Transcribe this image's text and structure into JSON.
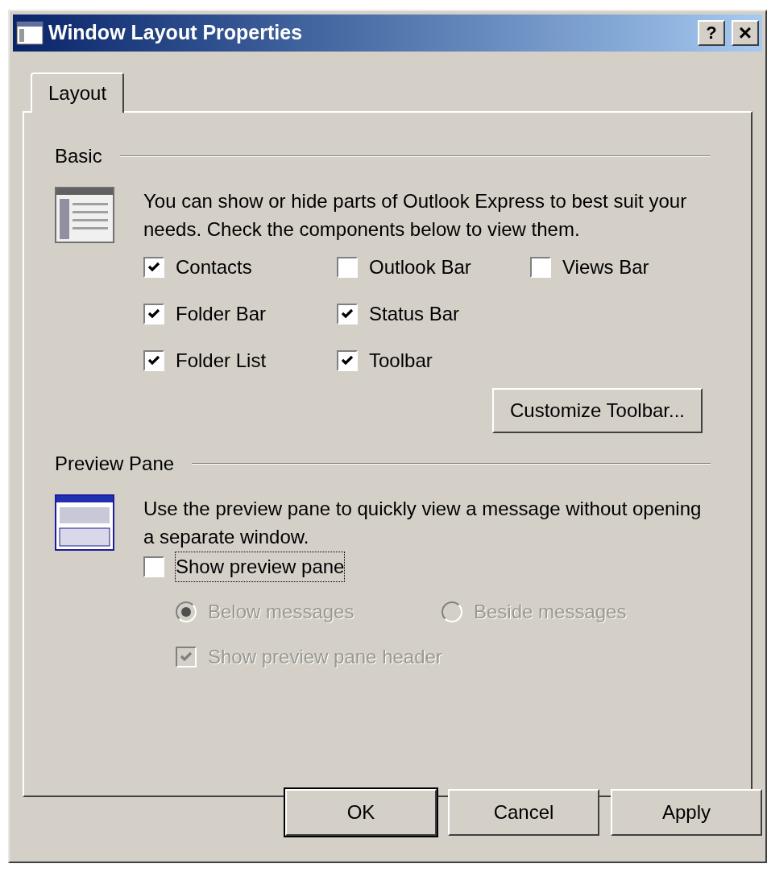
{
  "window": {
    "title": "Window Layout Properties",
    "help": "?",
    "close": "×"
  },
  "tabs": [
    {
      "label": "Layout",
      "selected": true
    }
  ],
  "basic": {
    "heading": "Basic",
    "description": "You can show or hide parts of Outlook Express to best suit your needs.  Check the components below to view them.",
    "columns": [
      [
        {
          "label": "Contacts",
          "checked": true
        },
        {
          "label": "Folder Bar",
          "checked": true
        },
        {
          "label": "Folder List",
          "checked": true
        }
      ],
      [
        {
          "label": "Outlook Bar",
          "checked": false
        },
        {
          "label": "Status Bar",
          "checked": true
        },
        {
          "label": "Toolbar",
          "checked": true
        }
      ],
      [
        {
          "label": "Views Bar",
          "checked": false
        }
      ]
    ],
    "button": "Customize Toolbar..."
  },
  "preview": {
    "heading": "Preview Pane",
    "description": "Use the preview pane to quickly view a message without opening a separate window.",
    "show": {
      "label": "Show preview pane",
      "checked": false,
      "focused": true
    },
    "radios": [
      {
        "label": "Below messages",
        "selected": true,
        "disabled": true
      },
      {
        "label": "Beside messages",
        "selected": false,
        "disabled": true
      }
    ],
    "header": {
      "label": "Show preview pane header",
      "checked": true,
      "disabled": true
    }
  },
  "buttons": [
    {
      "label": "OK",
      "default": true
    },
    {
      "label": "Cancel",
      "default": false
    },
    {
      "label": "Apply",
      "default": false
    }
  ]
}
